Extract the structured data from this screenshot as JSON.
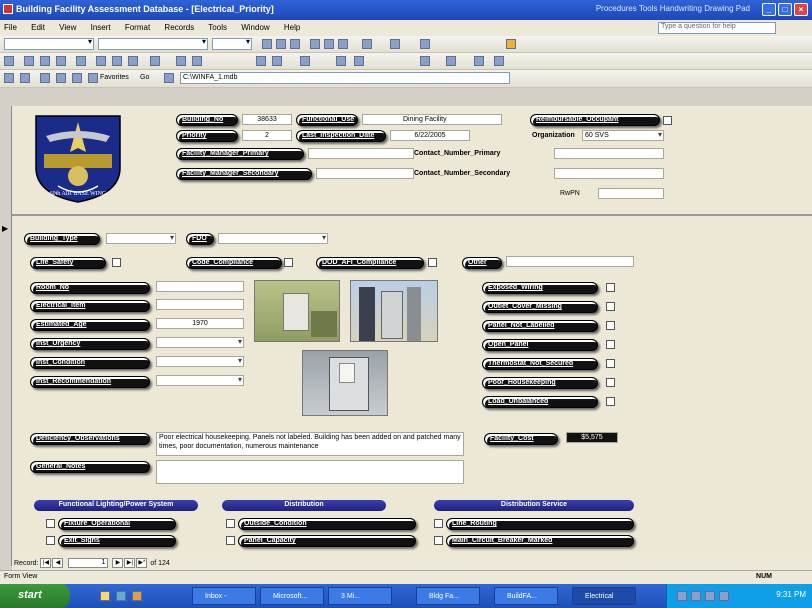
{
  "window": {
    "title": "Building Facility Assessment Database - [Electrical_Priority]",
    "right_text": "Procedures  Tools  Handwriting  Drawing Pad"
  },
  "menu": {
    "items": [
      "File",
      "Edit",
      "View",
      "Insert",
      "Format",
      "Records",
      "Tools",
      "Window",
      "Help"
    ],
    "help_placeholder": "Type a question for help"
  },
  "toolbar3": {
    "favorites": "Favorites",
    "go": "Go",
    "address": "C:\\WINFA_1.mdb"
  },
  "header": {
    "building_no_label": "Building_No",
    "building_no": "38633",
    "functional_use_label": "Functional_Use",
    "functional_use": "Dining Facility",
    "reimbursable_label": "Reimbursable_Occupant",
    "priority_label": "Priority",
    "priority": "2",
    "last_inspection_label": "Last_Inspection_Date",
    "last_inspection": "6/22/2005",
    "organization_label": "Organization",
    "organization": "60 SVS",
    "fm_primary_label": "Facility_Manager_Primary",
    "contact_primary_label": "Contact_Number_Primary",
    "fm_secondary_label": "Facility_Manager_Secondary",
    "contact_secondary_label": "Contact_Number_Secondary",
    "rwpn_label": "RwPN"
  },
  "logo": {
    "text": "60th AIR BASE WING"
  },
  "body": {
    "building_type_label": "Building_Type",
    "fdo_label": "FDO",
    "life_safety_label": "Life_Safety",
    "code_compliance_label": "Code_Compliance",
    "dod_afi_label": "DOD_AFI_Compliance",
    "other_label": "Other",
    "room_no_label": "Room_No",
    "electrical_item_label": "Electrical_Item",
    "estimated_age_label": "Estimated_Age",
    "estimated_age": "1970",
    "inst_urgency_label": "Inst_Urgency",
    "inst_condition_label": "Inst_Condition",
    "inst_recommendation_label": "Inst_Recommendation",
    "right_items": [
      "Exposed_Wiring",
      "Outlet_Cover_Missing",
      "Panel_Not_Labelled",
      "Open_Panel",
      "Thermostat_Not_Secured",
      "Poor_Housekeeping",
      "Load_Unbalanced"
    ],
    "deficiency_label": "Deficiency_Observations",
    "deficiency_text": "Poor electrical housekeeping. Panels not labeled. Building has been added on and patched many times, poor documentation, numerous maintenance",
    "facility_cost_label": "Facility_Cost",
    "facility_cost": "$5,575",
    "general_notes_label": "General_Notes",
    "sections": [
      {
        "title": "Functional Lighting/Power System",
        "items": [
          "Fixture_Operational",
          "Exit_Signs"
        ]
      },
      {
        "title": "Distribution",
        "items": [
          "Outside_Condition",
          "Panel_Capacity"
        ]
      },
      {
        "title": "Distribution Service",
        "items": [
          "Line_Routing",
          "Main_Circuit_Breaker_Marked"
        ]
      }
    ]
  },
  "navbar": {
    "record_label": "Record:",
    "current": "1",
    "of_text": "of 124"
  },
  "statusbar": {
    "mode": "Form View",
    "num": "NUM"
  },
  "taskbar": {
    "start": "start",
    "tasks": [
      "Inbox -",
      "Microsoft...",
      "3 Mi...",
      "Bldg Fa...",
      "BuildFA...",
      "Electrical"
    ],
    "clock": "9:31 PM"
  },
  "colors": {
    "title_blue": "#2f63d8",
    "form_bg": "#ede8d6",
    "section_blue": "#1d2280"
  }
}
